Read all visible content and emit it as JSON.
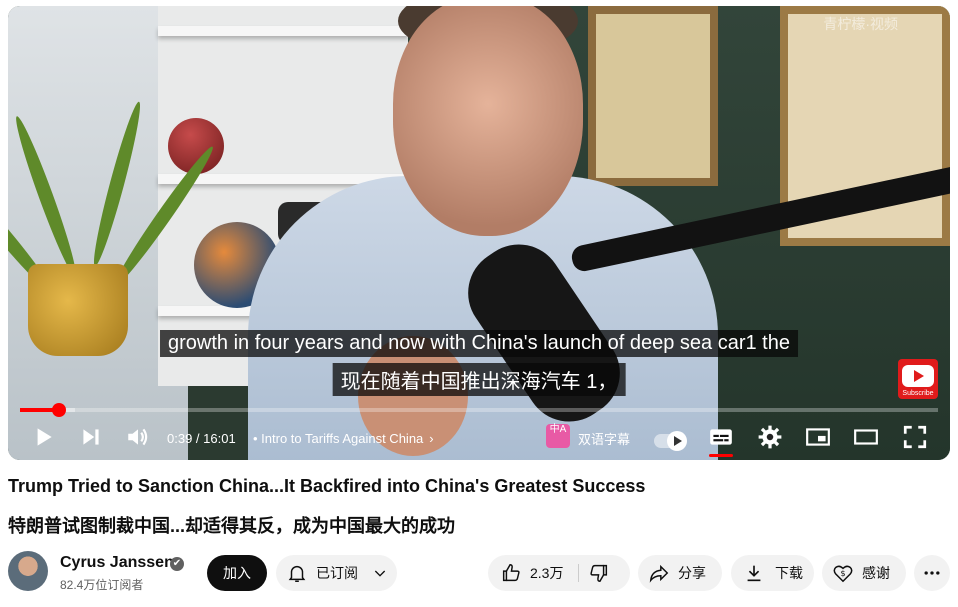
{
  "video": {
    "watermark": "青柠檬·视频",
    "caption_en": "growth in four years and now with China's launch of deep sea car1 the",
    "caption_zh": "现在随着中国推出深海汽车 1，",
    "subscribe_badge_text": "Subscribe",
    "progress": 0.043,
    "loaded": 0.06
  },
  "controls": {
    "current_time": "0:39",
    "duration": "16:01",
    "time_display": "0:39 / 16:01",
    "chapter": "• Intro to Tariffs Against China",
    "bilingual_icon_text": "中A",
    "bilingual_label": "双语字幕",
    "icons": [
      "play-icon",
      "next-icon",
      "volume-icon",
      "chevron-right-icon",
      "autoplay-toggle",
      "subtitles-icon",
      "settings-icon",
      "miniplayer-icon",
      "theater-icon",
      "fullscreen-icon"
    ]
  },
  "title": {
    "english": "Trump Tried to Sanction China...It Backfired into China's Greatest Success",
    "chinese": "特朗普试图制裁中国...却适得其反，成为中国最大的成功"
  },
  "channel": {
    "name": "Cyrus Janssen",
    "verified_icon": "✔",
    "subscribers": "82.4万位订阅者"
  },
  "actions": {
    "join": "加入",
    "subscribed": "已订阅",
    "likes": "2.3万",
    "share": "分享",
    "download": "下载",
    "thanks": "感谢"
  },
  "colors": {
    "accent": "#ff0000",
    "bilingual_badge": "#e85aa5"
  }
}
